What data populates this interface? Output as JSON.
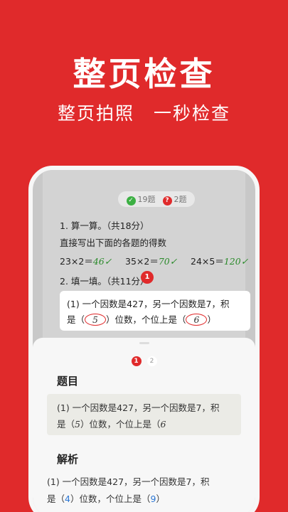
{
  "header": {
    "title": "整页检查",
    "subtitle": "整页拍照　一秒检查"
  },
  "status": {
    "correct": "19题",
    "wrong": "2题",
    "correct_icon": "check-icon",
    "wrong_icon": "question-icon"
  },
  "worksheet": {
    "section1": "1. 算一算。（共18分）",
    "section1_desc": "直接写出下面的各题的得数",
    "problems": [
      {
        "expr": "23×2＝",
        "answer": "46"
      },
      {
        "expr": "35×2＝",
        "answer": "70"
      },
      {
        "expr": "24×5＝",
        "answer": "120"
      }
    ],
    "section2": "2. 填一填。（共11分）",
    "marker": "1",
    "q1_line1": "(1) 一个因数是427，另一个因数是7，积",
    "q1_line2_a": "是（",
    "q1_hw1": "5",
    "q1_line2_b": "）位数，个位上是（",
    "q1_hw2": "6",
    "q1_line2_c": "）"
  },
  "sheet": {
    "pages": [
      "1",
      "2"
    ],
    "question_title": "题目",
    "q_line1": "(1) 一个因数是427，另一个因数是7，积",
    "q_line2_a": "是（",
    "q_hw1": "5",
    "q_line2_b": "）位数，个位上是（",
    "q_hw2": "6",
    "analysis_title": "解析",
    "a_line1": "(1) 一个因数是427，另一个因数是7，积",
    "a_line2_a": "是（",
    "a_ans1": "4",
    "a_line2_b": "）位数，个位上是（",
    "a_ans2": "9",
    "a_line2_c": "）"
  },
  "colors": {
    "brand": "#e02a2b",
    "correct": "#3cb043",
    "answer": "#2c77d4"
  }
}
